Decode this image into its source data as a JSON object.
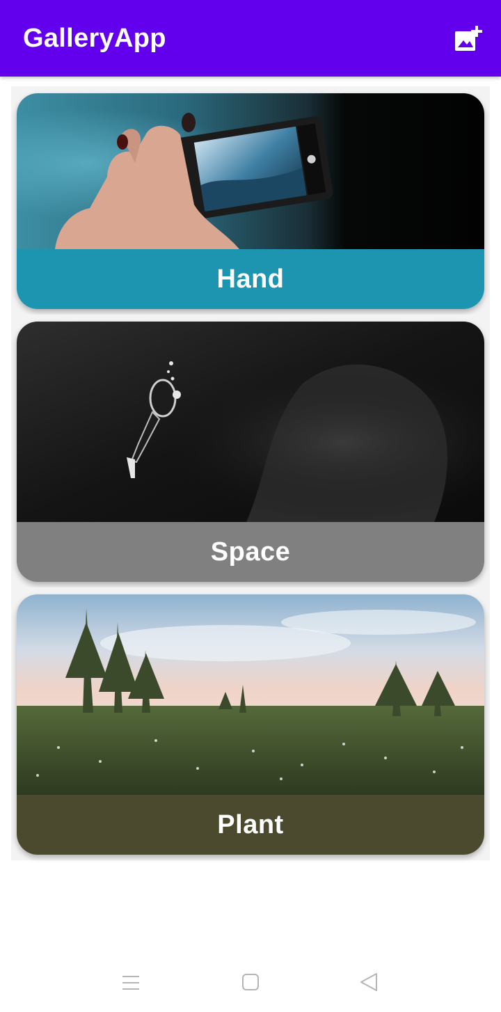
{
  "app_bar": {
    "title": "GalleryApp",
    "action_icon": "add-photo-icon",
    "color": "#6200ee"
  },
  "cards": [
    {
      "label": "Hand",
      "label_bg": "#1e95b0"
    },
    {
      "label": "Space",
      "label_bg": "#808080"
    },
    {
      "label": "Plant",
      "label_bg": "#4b4a2f"
    }
  ],
  "nav_bar": {
    "buttons": [
      "menu-icon",
      "home-icon",
      "back-icon"
    ]
  }
}
